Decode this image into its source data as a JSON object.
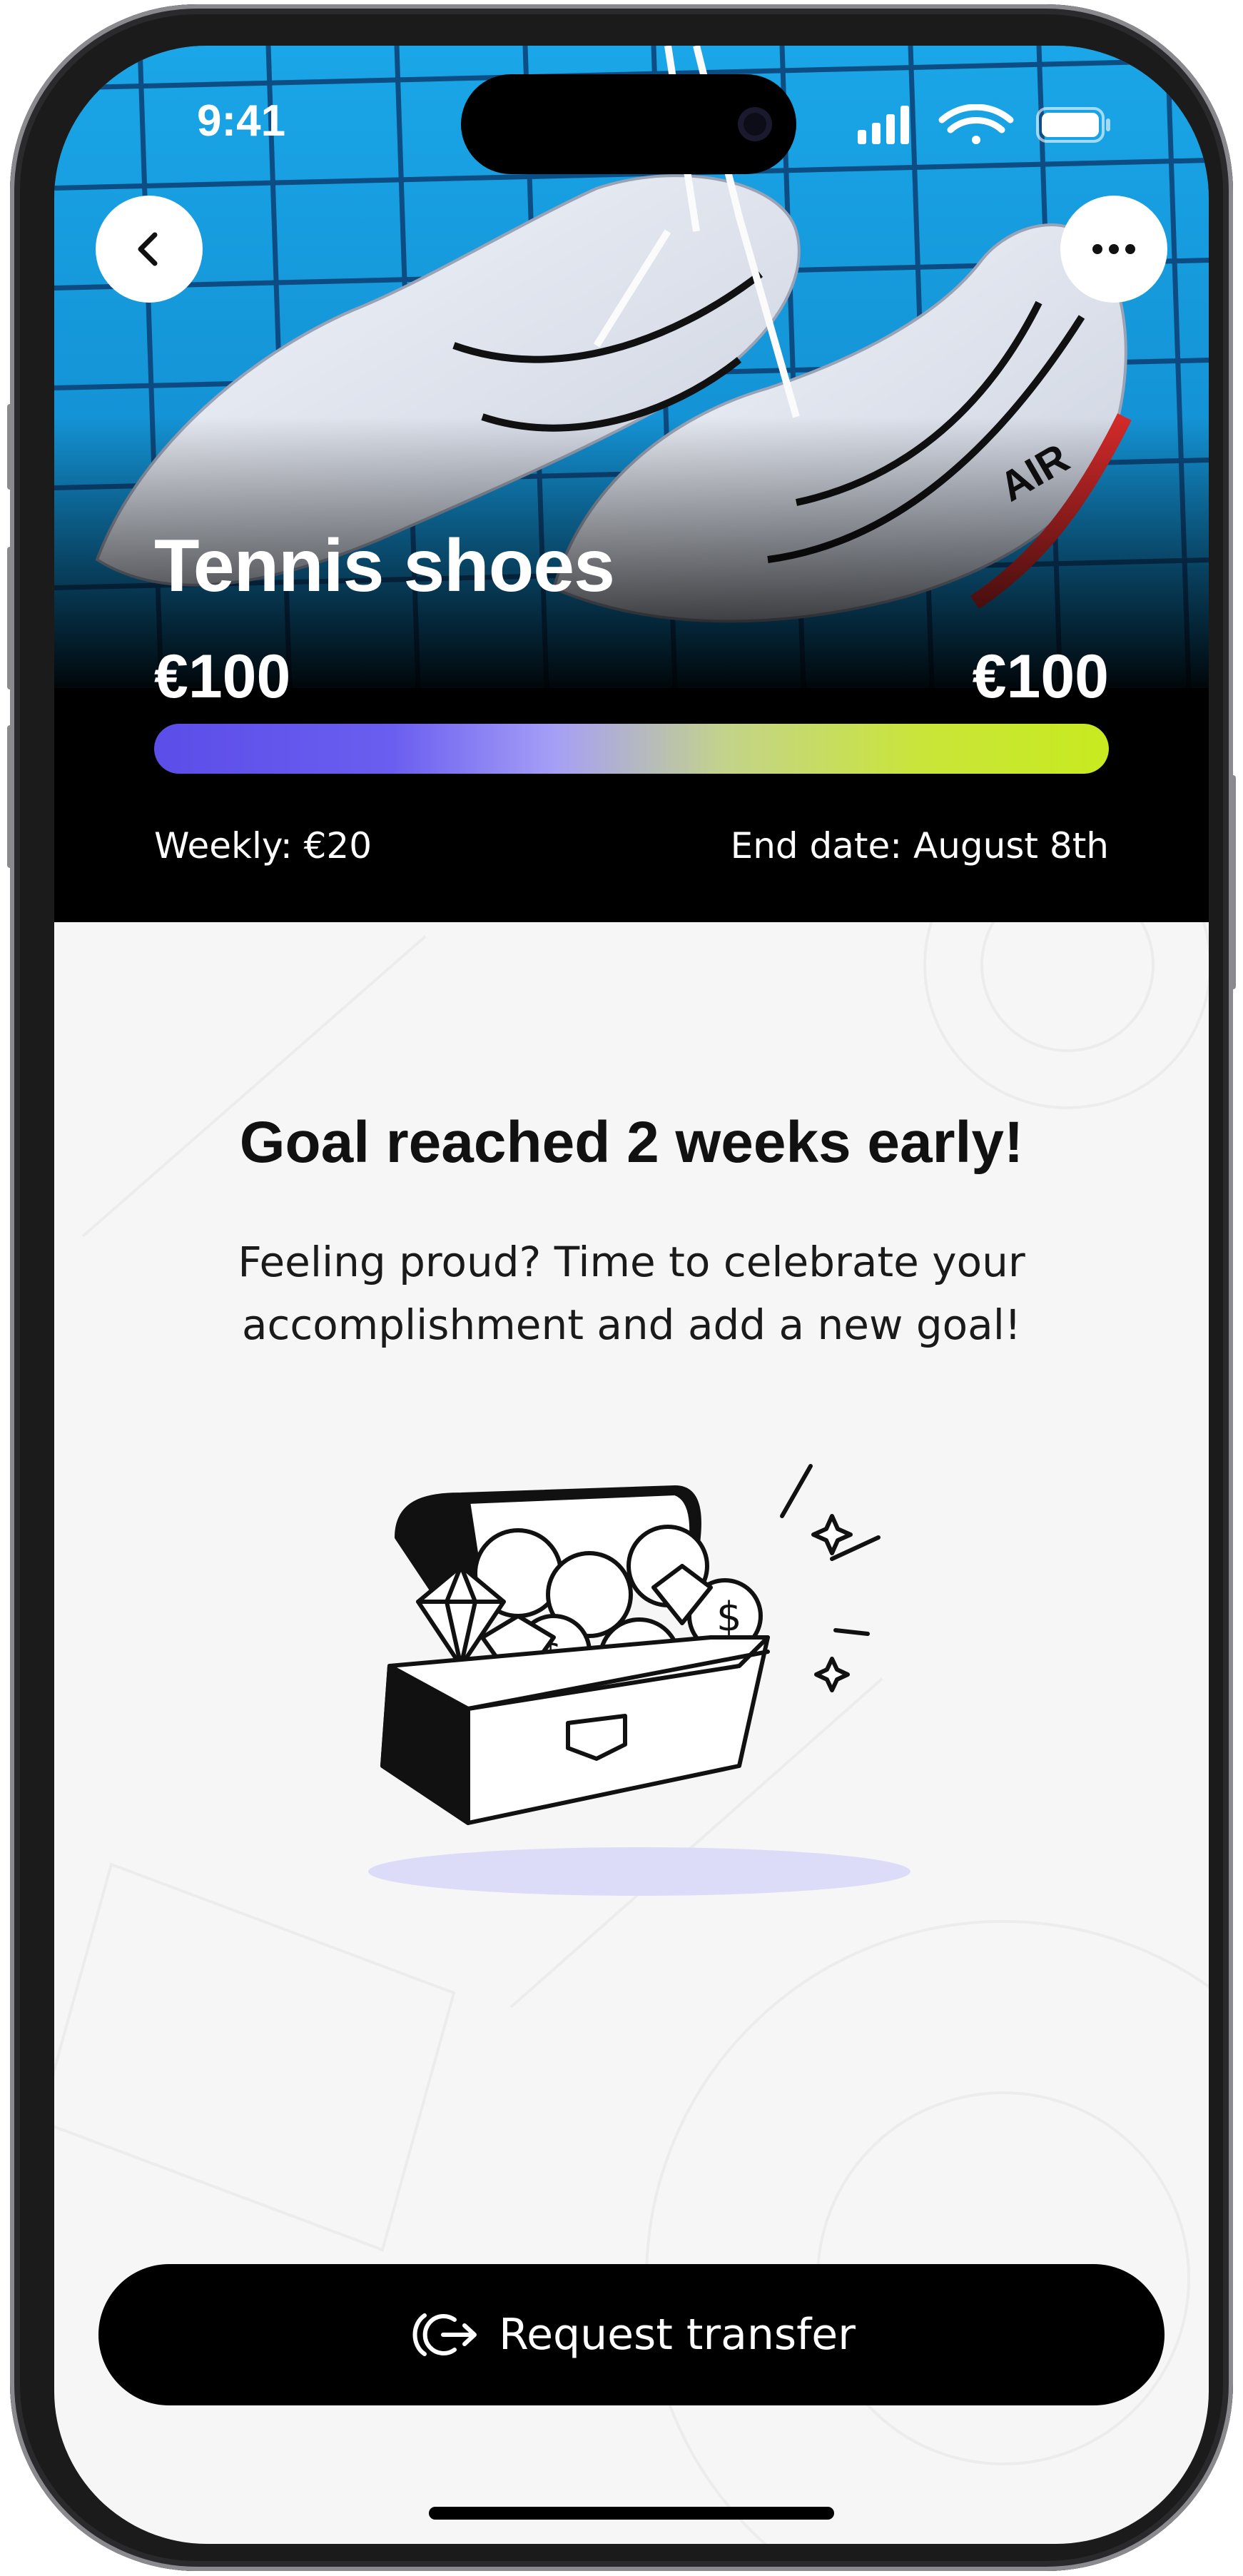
{
  "status_bar": {
    "time": "9:41"
  },
  "header": {
    "back_icon": "chevron-left-icon",
    "more_icon": "more-horizontal-icon"
  },
  "goal": {
    "title": "Tennis shoes",
    "saved_amount": "€100",
    "target_amount": "€100",
    "progress_fraction": 1.0,
    "weekly": "Weekly: €20",
    "end_date": "End date: August 8th"
  },
  "message": {
    "headline": "Goal reached 2 weeks early!",
    "body": "Feeling proud? Time to celebrate your accomplishment and add a new goal!",
    "illustration": "treasure-chest-illustration"
  },
  "action": {
    "label": "Request transfer",
    "icon": "transfer-out-icon"
  },
  "colors": {
    "progress_start": "#5b4de8",
    "progress_end": "#c8ea1f",
    "shadow_ellipse": "#dcdcf8"
  }
}
